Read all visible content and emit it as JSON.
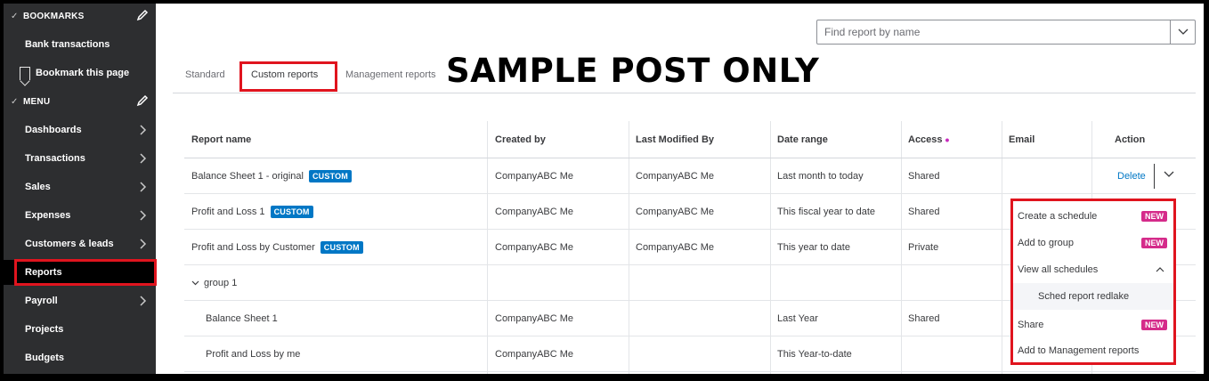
{
  "sidebar": {
    "bookmarks_header": "BOOKMARKS",
    "bookmark_items": [
      "Bank transactions"
    ],
    "bookmark_this_page": "Bookmark this page",
    "menu_header": "MENU",
    "menu_items": [
      {
        "label": "Dashboards",
        "has_chevron": true
      },
      {
        "label": "Transactions",
        "has_chevron": true
      },
      {
        "label": "Sales",
        "has_chevron": true
      },
      {
        "label": "Expenses",
        "has_chevron": true
      },
      {
        "label": "Customers & leads",
        "has_chevron": true
      },
      {
        "label": "Reports",
        "has_chevron": false,
        "active": true
      },
      {
        "label": "Payroll",
        "has_chevron": true
      },
      {
        "label": "Projects",
        "has_chevron": false
      },
      {
        "label": "Budgets",
        "has_chevron": false
      }
    ]
  },
  "search": {
    "placeholder": "Find report by name"
  },
  "tabs": [
    {
      "label": "Standard"
    },
    {
      "label": "Custom reports",
      "active": true
    },
    {
      "label": "Management reports"
    }
  ],
  "watermark": "SAMPLE POST ONLY",
  "table": {
    "headers": [
      "Report name",
      "Created by",
      "Last Modified By",
      "Date range",
      "Access",
      "Email",
      "Action"
    ],
    "rows": [
      {
        "name": "Balance Sheet 1 - original",
        "badge": "CUSTOM",
        "created_by": "CompanyABC Me",
        "modified_by": "CompanyABC Me",
        "date_range": "Last month to today",
        "access": "Shared",
        "action": "Delete"
      },
      {
        "name": "Profit and Loss 1",
        "badge": "CUSTOM",
        "created_by": "CompanyABC Me",
        "modified_by": "CompanyABC Me",
        "date_range": "This fiscal year to date",
        "access": "Shared"
      },
      {
        "name": "Profit and Loss by Customer",
        "badge": "CUSTOM",
        "created_by": "CompanyABC Me",
        "modified_by": "CompanyABC Me",
        "date_range": "This year to date",
        "access": "Private"
      },
      {
        "name": "group 1",
        "group": true
      },
      {
        "name": "Balance Sheet 1",
        "created_by": "CompanyABC Me",
        "modified_by": "",
        "date_range": "Last Year",
        "access": "Shared"
      },
      {
        "name": "Profit and Loss by me",
        "created_by": "CompanyABC Me",
        "modified_by": "",
        "date_range": "This Year-to-date",
        "access": ""
      }
    ]
  },
  "action_menu": {
    "items": [
      {
        "label": "Create a schedule",
        "badge": "NEW"
      },
      {
        "label": "Add to group",
        "badge": "NEW"
      },
      {
        "label": "View all schedules",
        "expanded": true
      },
      {
        "label": "Sched report redlake",
        "sub": true
      },
      {
        "label": "Share",
        "badge": "NEW"
      },
      {
        "label": "Add to Management reports"
      }
    ]
  },
  "colors": {
    "sidebar_bg": "#2d2e30",
    "link_blue": "#0077c5",
    "badge_blue": "#0077c5",
    "new_badge": "#d52b8a",
    "highlight_red": "#e0141e"
  }
}
